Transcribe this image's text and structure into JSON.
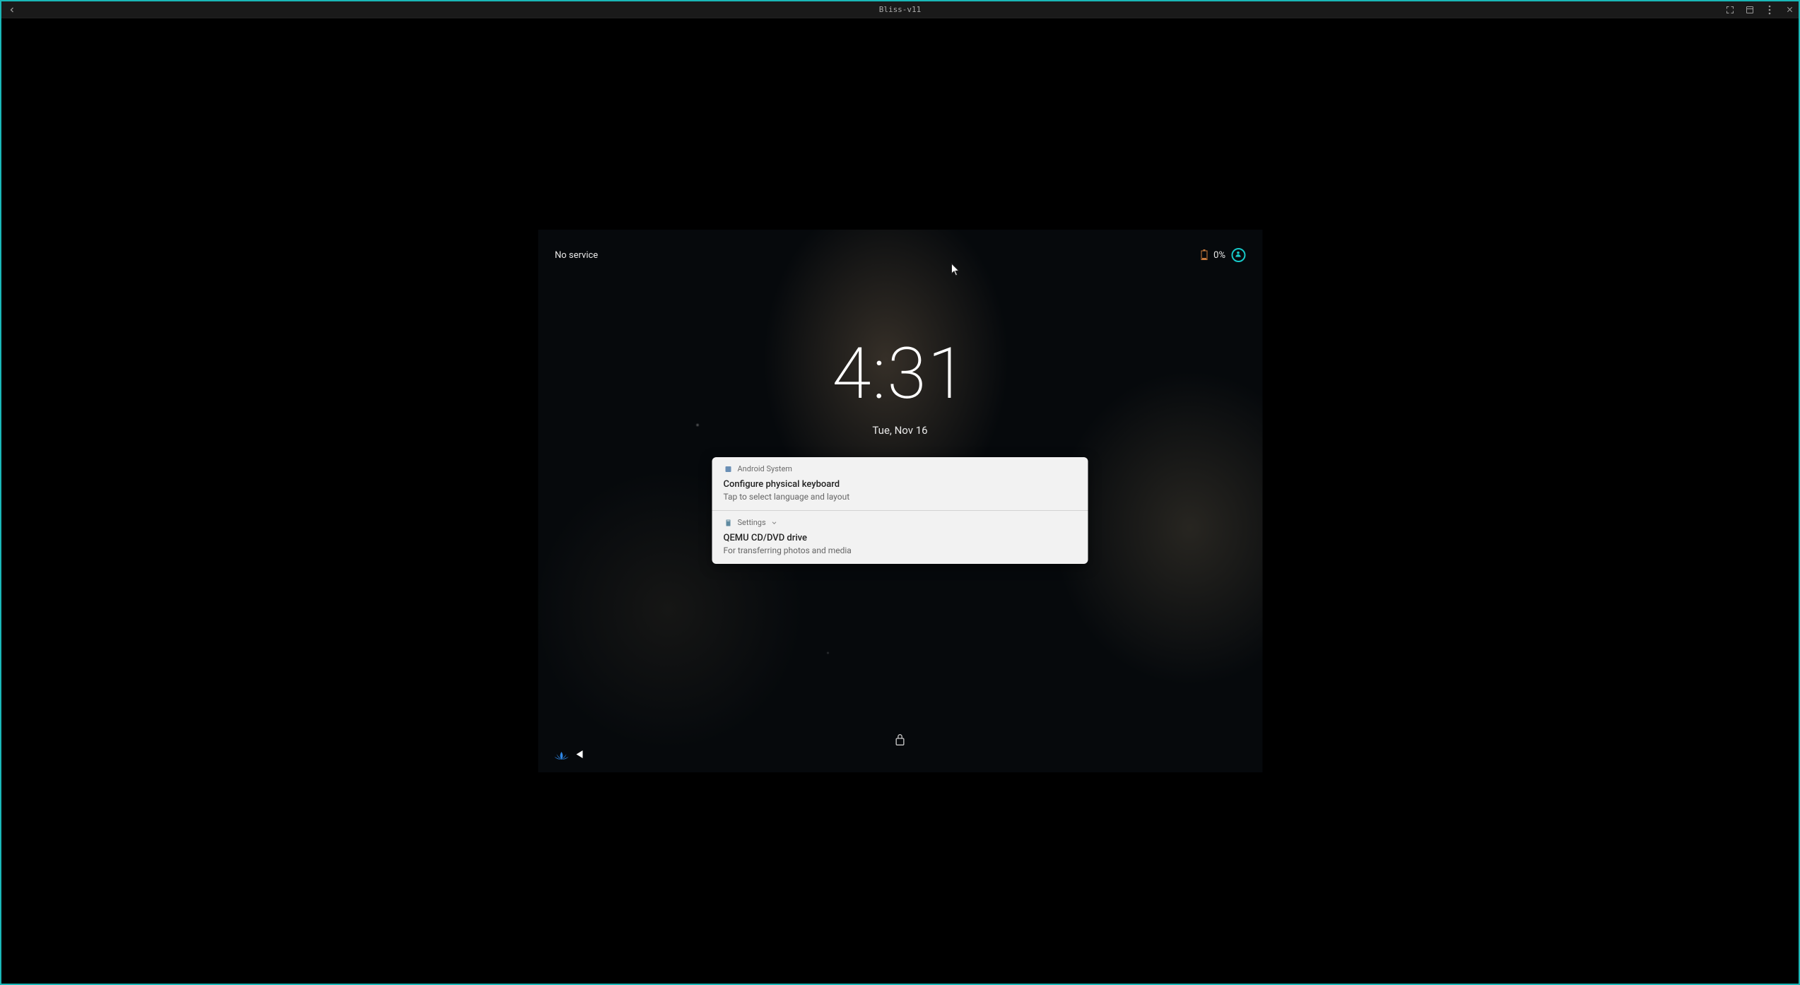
{
  "window": {
    "title": "Bliss-v11"
  },
  "status": {
    "service_label": "No service",
    "battery_pct": "0%"
  },
  "clock": {
    "time": "4:31",
    "date": "Tue, Nov 16"
  },
  "notifications": [
    {
      "app": "Android System",
      "icon_name": "android-icon",
      "icon_color": "#6a8fb5",
      "title": "Configure physical keyboard",
      "body": "Tap to select language and layout",
      "expandable": false
    },
    {
      "app": "Settings",
      "icon_name": "settings-icon",
      "icon_color": "#5f8aa0",
      "title": "QEMU CD/DVD drive",
      "body": "For transferring photos and media",
      "expandable": true
    }
  ]
}
